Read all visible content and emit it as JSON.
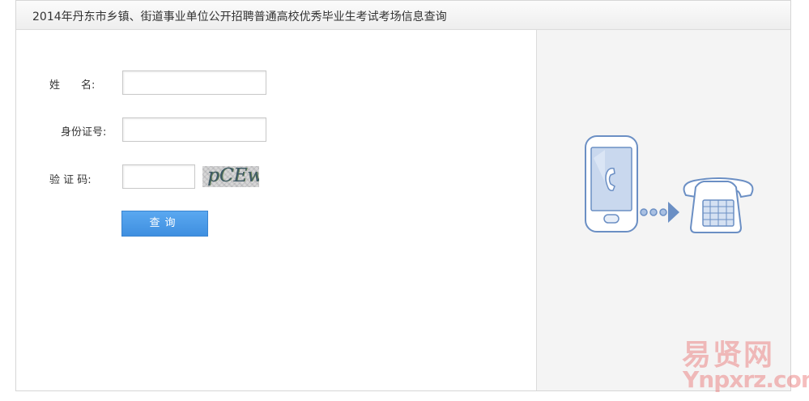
{
  "header": {
    "title": "2014年丹东市乡镇、街道事业单位公开招聘普通高校优秀毕业生考试考场信息查询"
  },
  "form": {
    "name_label": "姓　　名:",
    "id_label": "身份证号:",
    "captcha_label": "验 证 码:",
    "name_value": "",
    "id_value": "",
    "captcha_value": "",
    "captcha_text": "pCEw",
    "submit_label": "查询"
  },
  "illustration": {
    "icons": [
      "mobile-phone-icon",
      "dots-arrow-icon",
      "desk-telephone-icon"
    ]
  },
  "watermark": {
    "cn": "易贤网",
    "en": "Ynpxrz.com"
  },
  "colors": {
    "accent": "#4a9be8",
    "illustration_stroke": "#6b8fc4",
    "panel_bg": "#f4f4f4"
  }
}
